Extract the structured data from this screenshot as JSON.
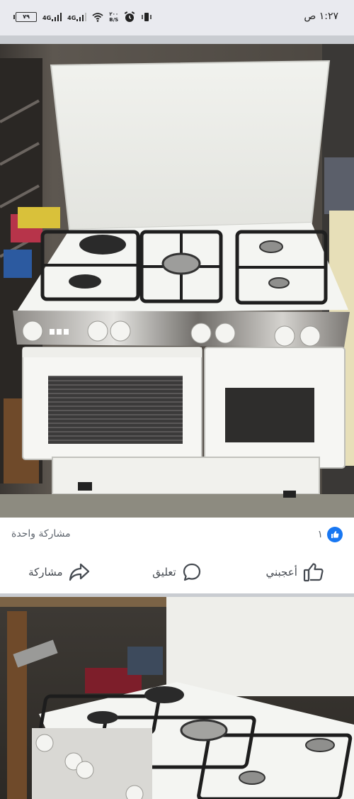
{
  "status_bar": {
    "time": "١:٢٧ ص",
    "battery": "٧٩",
    "network_1": "4G",
    "network_2": "4G",
    "speed_value": "٢٠٠",
    "speed_unit": "B/S"
  },
  "post": {
    "reaction_count": "١",
    "shares": "مشاركة واحدة"
  },
  "actions": {
    "like_label": "أعجبني",
    "comment_label": "تعليق",
    "share_label": "مشاركة"
  },
  "colors": {
    "facebook_blue": "#1877f2",
    "status_bg": "#e9eaef",
    "divider": "#c9ccd1"
  }
}
